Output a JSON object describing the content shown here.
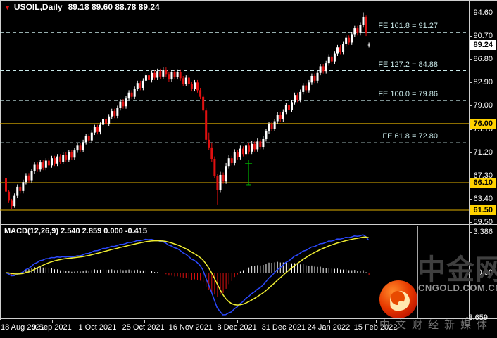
{
  "window": {
    "title_symbol": "USOIL,Daily",
    "title_values": "89.18 89.60 88.78 89.24"
  },
  "price_axis": {
    "ticks": [
      94.6,
      90.7,
      86.8,
      82.9,
      79.0,
      75.1,
      71.2,
      67.3,
      63.4,
      59.5
    ],
    "current_price": 89.24,
    "level_boxes": [
      76.0,
      66.1,
      61.5
    ]
  },
  "time_axis": {
    "labels": [
      "18 Aug 2021",
      "9 Sep 2021",
      "1 Oct 2021",
      "25 Oct 2021",
      "16 Nov 2021",
      "8 Dec 2021",
      "31 Dec 2021",
      "24 Jan 2022",
      "15 Feb 2022"
    ]
  },
  "macd_panel": {
    "label": "MACD(12,26,9) 2.540 2.859 0.000 -0.415",
    "scale_max": "3.386",
    "scale_zero": "0.00",
    "scale_min": "-3.659"
  },
  "watermark": {
    "brand": "中金网",
    "domain": "CNGOLD.COM.CN",
    "tagline": "中文财经新媒体"
  },
  "colors": {
    "background": "#000000",
    "bull": "#ffffff",
    "bear": "#e01010",
    "level_line": "#e0b000",
    "level_box_bg": "#ffd200",
    "fib_line": "#c8e8e8",
    "macd_line": "#2b49ff",
    "signal_line": "#f0ee32",
    "hist_pos": "#ffffff",
    "hist_neg": "#e01010",
    "frame": "#cfcfcf",
    "anchor_green": "#00b400"
  },
  "chart_data": {
    "type": "candlestick",
    "symbol": "USOIL",
    "timeframe": "Daily",
    "title": "USOIL,Daily 89.18 89.60 88.78 89.24",
    "last_ohlc": {
      "open": 89.18,
      "high": 89.6,
      "low": 88.78,
      "close": 89.24
    },
    "y_ticks": [
      94.6,
      90.7,
      86.8,
      82.9,
      79.0,
      75.1,
      71.2,
      67.3,
      63.4,
      59.5
    ],
    "ylim": [
      59.5,
      95.5
    ],
    "x_tick_labels": [
      "18 Aug 2021",
      "9 Sep 2021",
      "1 Oct 2021",
      "25 Oct 2021",
      "16 Nov 2021",
      "8 Dec 2021",
      "31 Dec 2021",
      "24 Jan 2022",
      "15 Feb 2022"
    ],
    "price_levels": [
      76.0,
      66.1,
      61.5
    ],
    "fib_extension": [
      {
        "label": "FE 161.8 = 91.27",
        "level": 161.8,
        "price": 91.27
      },
      {
        "label": "FE 127.2 = 84.88",
        "level": 127.2,
        "price": 84.88
      },
      {
        "label": "FE 100.0 = 79.86",
        "level": 100.0,
        "price": 79.86
      },
      {
        "label": "FE 61.8 = 72.80",
        "level": 61.8,
        "price": 72.8
      }
    ],
    "indicator": {
      "name": "MACD",
      "params": [
        12,
        26,
        9
      ],
      "display_values": [
        2.54,
        2.859,
        0.0,
        -0.415
      ],
      "scale": {
        "max": 3.386,
        "zero": 0.0,
        "min": -3.659
      },
      "legend_position": "top-left"
    },
    "annotations": {
      "green_anchor": {
        "x_index": 85,
        "price_top": 69.3,
        "price_bottom": 65.75
      }
    },
    "grid": false,
    "ohlc": [
      [
        66.8,
        67.1,
        64.2,
        64.6
      ],
      [
        64.6,
        64.9,
        62.7,
        63.1
      ],
      [
        63.1,
        63.4,
        61.74,
        62.2
      ],
      [
        62.2,
        64.3,
        61.9,
        63.9
      ],
      [
        63.9,
        65.8,
        63.5,
        65.4
      ],
      [
        65.4,
        65.8,
        64.3,
        64.7
      ],
      [
        64.7,
        66.6,
        64.3,
        66.2
      ],
      [
        66.2,
        67.7,
        65.8,
        67.3
      ],
      [
        67.3,
        67.7,
        66.1,
        66.5
      ],
      [
        66.5,
        68.4,
        66.1,
        68.0
      ],
      [
        68.0,
        69.5,
        67.6,
        69.1
      ],
      [
        69.1,
        69.5,
        67.9,
        68.3
      ],
      [
        68.3,
        69.9,
        67.9,
        69.5
      ],
      [
        69.5,
        69.9,
        68.2,
        68.6
      ],
      [
        68.6,
        70.2,
        68.2,
        69.8
      ],
      [
        69.8,
        70.2,
        68.6,
        69.0
      ],
      [
        69.0,
        70.6,
        68.6,
        70.2
      ],
      [
        70.2,
        70.6,
        68.9,
        69.3
      ],
      [
        69.3,
        70.9,
        68.9,
        70.5
      ],
      [
        70.5,
        70.9,
        69.2,
        69.6
      ],
      [
        69.6,
        71.2,
        69.2,
        70.8
      ],
      [
        70.8,
        71.2,
        69.6,
        70.0
      ],
      [
        70.0,
        71.6,
        69.6,
        71.2
      ],
      [
        71.2,
        71.6,
        69.9,
        70.3
      ],
      [
        70.3,
        71.9,
        69.9,
        71.5
      ],
      [
        71.5,
        72.7,
        71.1,
        72.3
      ],
      [
        72.3,
        72.7,
        71.2,
        71.6
      ],
      [
        71.6,
        73.3,
        71.2,
        72.9
      ],
      [
        72.9,
        74.3,
        72.5,
        73.9
      ],
      [
        73.9,
        74.3,
        72.8,
        73.2
      ],
      [
        73.2,
        74.9,
        72.8,
        74.5
      ],
      [
        74.5,
        75.8,
        74.1,
        75.4
      ],
      [
        75.4,
        75.8,
        74.2,
        74.6
      ],
      [
        74.6,
        76.2,
        74.2,
        75.8
      ],
      [
        75.8,
        77.2,
        75.4,
        76.8
      ],
      [
        76.8,
        77.2,
        75.6,
        76.0
      ],
      [
        76.0,
        77.6,
        75.6,
        77.2
      ],
      [
        77.2,
        78.5,
        76.8,
        78.1
      ],
      [
        78.1,
        78.5,
        76.9,
        77.3
      ],
      [
        77.3,
        79.0,
        76.9,
        78.6
      ],
      [
        78.6,
        80.1,
        78.2,
        79.7
      ],
      [
        79.7,
        80.1,
        78.5,
        78.9
      ],
      [
        78.9,
        80.6,
        78.5,
        80.2
      ],
      [
        80.2,
        81.6,
        79.8,
        81.2
      ],
      [
        81.2,
        81.6,
        80.1,
        80.5
      ],
      [
        80.5,
        82.2,
        80.1,
        81.8
      ],
      [
        81.8,
        83.2,
        81.4,
        82.8
      ],
      [
        82.8,
        83.2,
        81.6,
        82.0
      ],
      [
        82.0,
        83.6,
        81.6,
        83.2
      ],
      [
        83.2,
        84.5,
        82.8,
        84.1
      ],
      [
        84.1,
        84.5,
        82.9,
        83.3
      ],
      [
        83.3,
        84.9,
        82.9,
        84.5
      ],
      [
        84.5,
        84.9,
        83.3,
        83.7
      ],
      [
        83.7,
        85.2,
        83.3,
        84.8
      ],
      [
        84.8,
        85.2,
        83.5,
        83.9
      ],
      [
        83.9,
        85.4,
        83.5,
        85.0
      ],
      [
        85.0,
        85.4,
        83.8,
        84.2
      ],
      [
        84.2,
        84.6,
        83.0,
        83.4
      ],
      [
        83.4,
        85.0,
        83.0,
        84.6
      ],
      [
        84.6,
        85.0,
        83.4,
        83.8
      ],
      [
        83.8,
        85.1,
        83.4,
        84.7
      ],
      [
        84.7,
        85.1,
        83.2,
        83.6
      ],
      [
        83.6,
        84.0,
        82.3,
        82.7
      ],
      [
        82.7,
        84.1,
        82.3,
        83.7
      ],
      [
        83.7,
        84.1,
        82.2,
        82.6
      ],
      [
        82.6,
        83.0,
        81.4,
        81.8
      ],
      [
        81.8,
        83.3,
        81.4,
        82.9
      ],
      [
        82.9,
        83.3,
        81.2,
        81.6
      ],
      [
        81.6,
        82.0,
        80.1,
        80.5
      ],
      [
        80.5,
        80.9,
        77.8,
        78.2
      ],
      [
        78.2,
        78.6,
        72.6,
        73.3
      ],
      [
        73.3,
        74.5,
        71.6,
        72.0
      ],
      [
        72.0,
        72.8,
        69.6,
        70.1
      ],
      [
        70.1,
        70.5,
        66.8,
        67.2
      ],
      [
        67.2,
        67.6,
        62.34,
        64.9
      ],
      [
        64.9,
        67.9,
        64.5,
        67.4
      ],
      [
        67.4,
        67.8,
        65.9,
        66.3
      ],
      [
        66.3,
        69.4,
        65.9,
        68.9
      ],
      [
        68.9,
        70.7,
        68.5,
        70.2
      ],
      [
        70.2,
        70.6,
        69.0,
        69.4
      ],
      [
        69.4,
        71.7,
        69.0,
        71.2
      ],
      [
        71.2,
        71.6,
        70.0,
        70.4
      ],
      [
        70.4,
        72.3,
        70.0,
        71.8
      ],
      [
        71.8,
        72.2,
        70.5,
        70.9
      ],
      [
        70.9,
        72.8,
        70.5,
        72.3
      ],
      [
        72.3,
        72.7,
        70.9,
        71.3
      ],
      [
        71.3,
        73.1,
        70.9,
        72.6
      ],
      [
        72.6,
        73.0,
        71.3,
        71.7
      ],
      [
        71.7,
        73.5,
        71.3,
        73.0
      ],
      [
        73.0,
        73.4,
        71.7,
        72.1
      ],
      [
        72.1,
        73.9,
        71.7,
        73.4
      ],
      [
        73.4,
        75.1,
        73.0,
        74.7
      ],
      [
        74.7,
        76.3,
        74.3,
        75.9
      ],
      [
        75.9,
        76.3,
        74.7,
        75.1
      ],
      [
        75.1,
        76.8,
        74.7,
        76.4
      ],
      [
        76.4,
        77.9,
        76.0,
        77.5
      ],
      [
        77.5,
        77.9,
        76.3,
        76.7
      ],
      [
        76.7,
        78.4,
        76.3,
        78.0
      ],
      [
        78.0,
        79.5,
        77.6,
        79.1
      ],
      [
        79.1,
        79.5,
        77.9,
        78.3
      ],
      [
        78.3,
        80.0,
        77.9,
        79.6
      ],
      [
        79.6,
        81.2,
        79.2,
        80.8
      ],
      [
        80.8,
        81.2,
        79.6,
        80.0
      ],
      [
        80.0,
        81.7,
        79.6,
        81.3
      ],
      [
        81.3,
        82.8,
        80.9,
        82.4
      ],
      [
        82.4,
        82.8,
        81.2,
        81.6
      ],
      [
        81.6,
        83.3,
        81.2,
        82.9
      ],
      [
        82.9,
        84.4,
        82.5,
        84.0
      ],
      [
        84.0,
        84.4,
        82.8,
        83.2
      ],
      [
        83.2,
        84.9,
        82.8,
        84.5
      ],
      [
        84.5,
        86.0,
        84.1,
        85.6
      ],
      [
        85.6,
        86.0,
        84.4,
        84.8
      ],
      [
        84.8,
        86.5,
        84.4,
        86.1
      ],
      [
        86.1,
        87.6,
        85.7,
        87.2
      ],
      [
        87.2,
        87.6,
        86.0,
        86.4
      ],
      [
        86.4,
        88.1,
        86.0,
        87.7
      ],
      [
        87.7,
        89.2,
        87.3,
        88.8
      ],
      [
        88.8,
        89.2,
        87.6,
        88.0
      ],
      [
        88.0,
        89.7,
        87.6,
        89.3
      ],
      [
        89.3,
        90.8,
        88.9,
        90.4
      ],
      [
        90.4,
        90.8,
        89.2,
        89.6
      ],
      [
        89.6,
        91.3,
        89.2,
        90.9
      ],
      [
        90.9,
        92.4,
        90.5,
        92.0
      ],
      [
        92.0,
        92.4,
        90.8,
        91.2
      ],
      [
        91.2,
        92.9,
        90.8,
        92.5
      ],
      [
        92.5,
        94.66,
        92.1,
        93.9
      ],
      [
        93.9,
        94.1,
        90.7,
        91.2
      ],
      [
        89.18,
        89.6,
        88.78,
        89.24
      ]
    ]
  }
}
